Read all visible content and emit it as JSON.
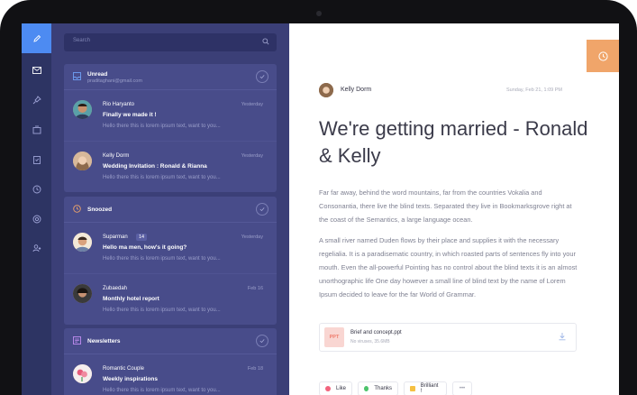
{
  "search": {
    "placeholder": "Search"
  },
  "groups": {
    "unread": {
      "title": "Unread",
      "subtitle": "praditaghani@gmail.com",
      "items": [
        {
          "name": "Rio Haryanto",
          "time": "Yesterday",
          "subject": "Finally we made it !",
          "snippet": "Hello there this is lorem ipsum text, want to you..."
        },
        {
          "name": "Kelly Dorm",
          "time": "Yesterday",
          "subject": "Wedding Invitation : Ronald & Rianna",
          "snippet": "Hello there this is lorem ipsum text, want to you..."
        }
      ]
    },
    "snoozed": {
      "title": "Snoozed",
      "items": [
        {
          "name": "Suparman",
          "badge": "14",
          "time": "Yesterday",
          "subject": "Hello ma men, how's it going?",
          "snippet": "Hello there this is lorem ipsum text, want to you..."
        },
        {
          "name": "Zubaedah",
          "time": "Feb 16",
          "subject": "Monthly hotel report",
          "snippet": "Hello there this is lorem ipsum text, want to you..."
        }
      ]
    },
    "newsletters": {
      "title": "Newsletters",
      "items": [
        {
          "name": "Romantic Couple",
          "time": "Feb 18",
          "subject": "Weekly inspirations",
          "snippet": "Hello there this is lorem ipsum text, want to you..."
        }
      ]
    }
  },
  "message": {
    "sender": "Kelly Dorm",
    "date": "Sunday, Feb 21, 1:09 PM",
    "title": "We're getting married - Ronald & Kelly",
    "paragraphs": [
      "Far far away, behind the word mountains, far from the countries Vokalia and Consonantia, there live the blind texts. Separated they live in Bookmarksgrove right at the coast of the Semantics, a large language ocean.",
      "A small river named Duden flows by their place and supplies it with the necessary regelialia. It is a paradisematic country, in which roasted parts of sentences fly into your mouth. Even the all-powerful Pointing has no control about the blind texts it is an almost unorthographic life One day however a small line of blind text by the name of Lorem Ipsum decided to leave for the far World of Grammar."
    ],
    "attachment": {
      "type": "PPT",
      "name": "Brief and concept.ppt",
      "meta": "No viruses, 35.6MB"
    },
    "reactions": [
      {
        "label": "Like",
        "color": "#f2637d"
      },
      {
        "label": "Thanks",
        "color": "#4cc36b"
      },
      {
        "label": "Brilliant !",
        "color": "#f5c042"
      },
      {
        "label": "•••",
        "color": ""
      }
    ]
  },
  "colors": {
    "accent": "#4d8bf2",
    "snooze_button": "#f0a56a",
    "sidebar": "#2d3463",
    "list_panel": "#3b3f77"
  }
}
